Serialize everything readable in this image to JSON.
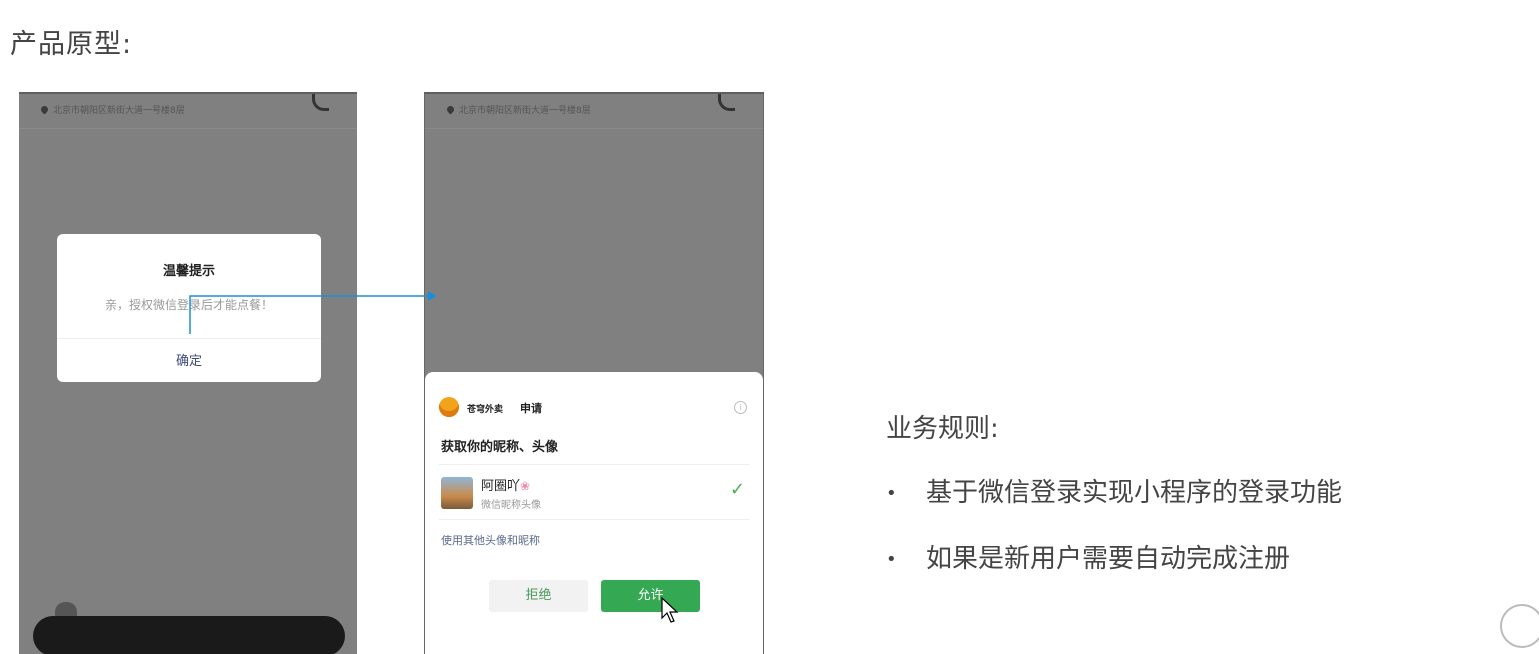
{
  "heading": "产品原型:",
  "left_phone": {
    "address": "北京市朝阳区新街大道一号楼8层",
    "dialog": {
      "title": "温馨提示",
      "message": "亲，授权微信登录后才能点餐！",
      "confirm": "确定"
    }
  },
  "right_phone": {
    "address": "北京市朝阳区新街大道一号楼8层",
    "sheet": {
      "app_name": "苍穹外卖",
      "action": "申请",
      "title": "获取你的昵称、头像",
      "user_name": "阿圈吖",
      "user_sub": "微信昵称头像",
      "other_link": "使用其他头像和昵称",
      "reject": "拒绝",
      "allow": "允许"
    }
  },
  "rules": {
    "title": "业务规则:",
    "items": [
      "基于微信登录实现小程序的登录功能",
      "如果是新用户需要自动完成注册"
    ]
  },
  "colors": {
    "connector": "#1a8fd8",
    "allow_button": "#34a853"
  }
}
